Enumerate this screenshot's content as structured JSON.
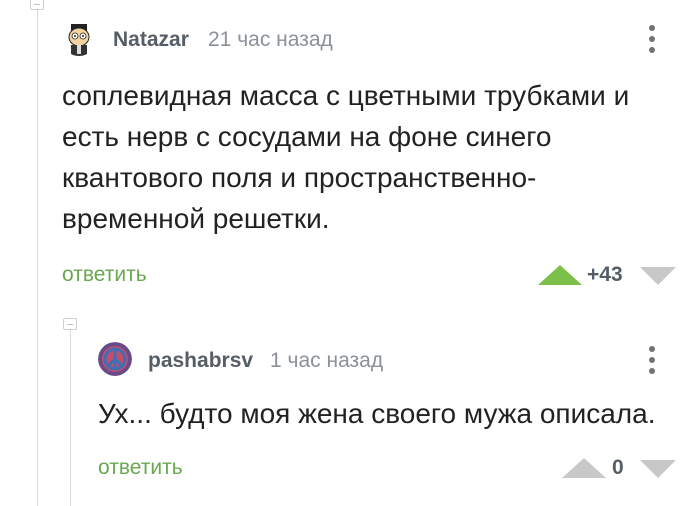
{
  "comments": [
    {
      "author": "Natazar",
      "time": "21 час назад",
      "text_lines": [
        "соплевидная масса с цветными трубками и",
        "есть нерв с сосудами на фоне синего",
        "квантового поля и пространственно-",
        "временной решетки."
      ],
      "reply_label": "ответить",
      "score": "+43"
    },
    {
      "author": "pashabrsv",
      "time": "1 час назад",
      "text_lines": [
        "Ух... будто моя жена своего мужа описала."
      ],
      "reply_label": "ответить",
      "score": "0"
    }
  ],
  "colors": {
    "accent_green": "#6aa84f",
    "upvote_active": "#7cbf4a",
    "vote_neutral": "#c8c8c8",
    "meta_gray": "#8a9199"
  },
  "icons": {
    "top_collapse": "collapse-minus-icon",
    "avatar1": "cartoon-avatar-icon",
    "avatar2": "peace-symbol-avatar-icon",
    "menu": "vertical-dots-icon",
    "upvote": "triangle-up-icon",
    "downvote": "triangle-down-icon"
  }
}
